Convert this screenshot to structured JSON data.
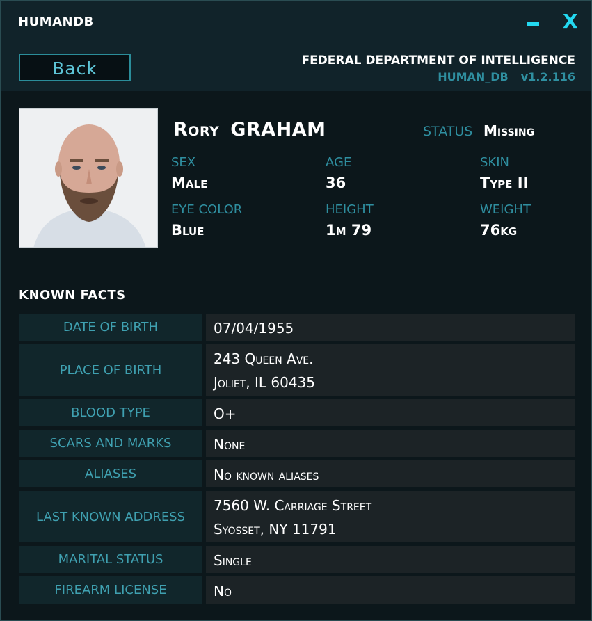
{
  "window": {
    "title": "HUMANDB",
    "controls": {
      "minimize_icon": "minimize-icon",
      "close_label": "X"
    }
  },
  "header": {
    "back_label": "Back",
    "agency": "FEDERAL DEPARTMENT OF INTELLIGENCE",
    "db_name": "HUMAN_DB",
    "version": "v1.2.116"
  },
  "profile": {
    "first_name": "Rory",
    "last_name": "GRAHAM",
    "status_label": "STATUS",
    "status_value": "Missing",
    "attributes": [
      {
        "label": "SEX",
        "value": "Male"
      },
      {
        "label": "AGE",
        "value": "36"
      },
      {
        "label": "SKIN",
        "value": "Type II"
      },
      {
        "label": "EYE COLOR",
        "value": "Blue"
      },
      {
        "label": "HEIGHT",
        "value": "1m 79"
      },
      {
        "label": "WEIGHT",
        "value": "76kg"
      }
    ]
  },
  "facts": {
    "title": "KNOWN  FACTS",
    "rows": [
      {
        "label": "DATE OF BIRTH",
        "lines": [
          "07/04/1955"
        ]
      },
      {
        "label": "PLACE OF BIRTH",
        "lines": [
          "243 Queen  Ave.",
          "Joliet, IL 60435"
        ]
      },
      {
        "label": "BLOOD TYPE",
        "lines": [
          "O+"
        ]
      },
      {
        "label": "SCARS AND MARKS",
        "lines": [
          "None"
        ]
      },
      {
        "label": "ALIASES",
        "lines": [
          "No known aliases"
        ]
      },
      {
        "label": "LAST KNOWN ADDRESS",
        "lines": [
          "7560 W. Carriage Street",
          "Syosset, NY 11791"
        ]
      },
      {
        "label": "MARITAL STATUS",
        "lines": [
          "Single"
        ]
      },
      {
        "label": "FIREARM LICENSE",
        "lines": [
          "No"
        ]
      }
    ]
  },
  "colors": {
    "accent": "#23d8f0",
    "label": "#2f8fa0",
    "panel": "#11232a",
    "row_label_bg": "#11262b",
    "row_value_bg": "#1c2326"
  }
}
